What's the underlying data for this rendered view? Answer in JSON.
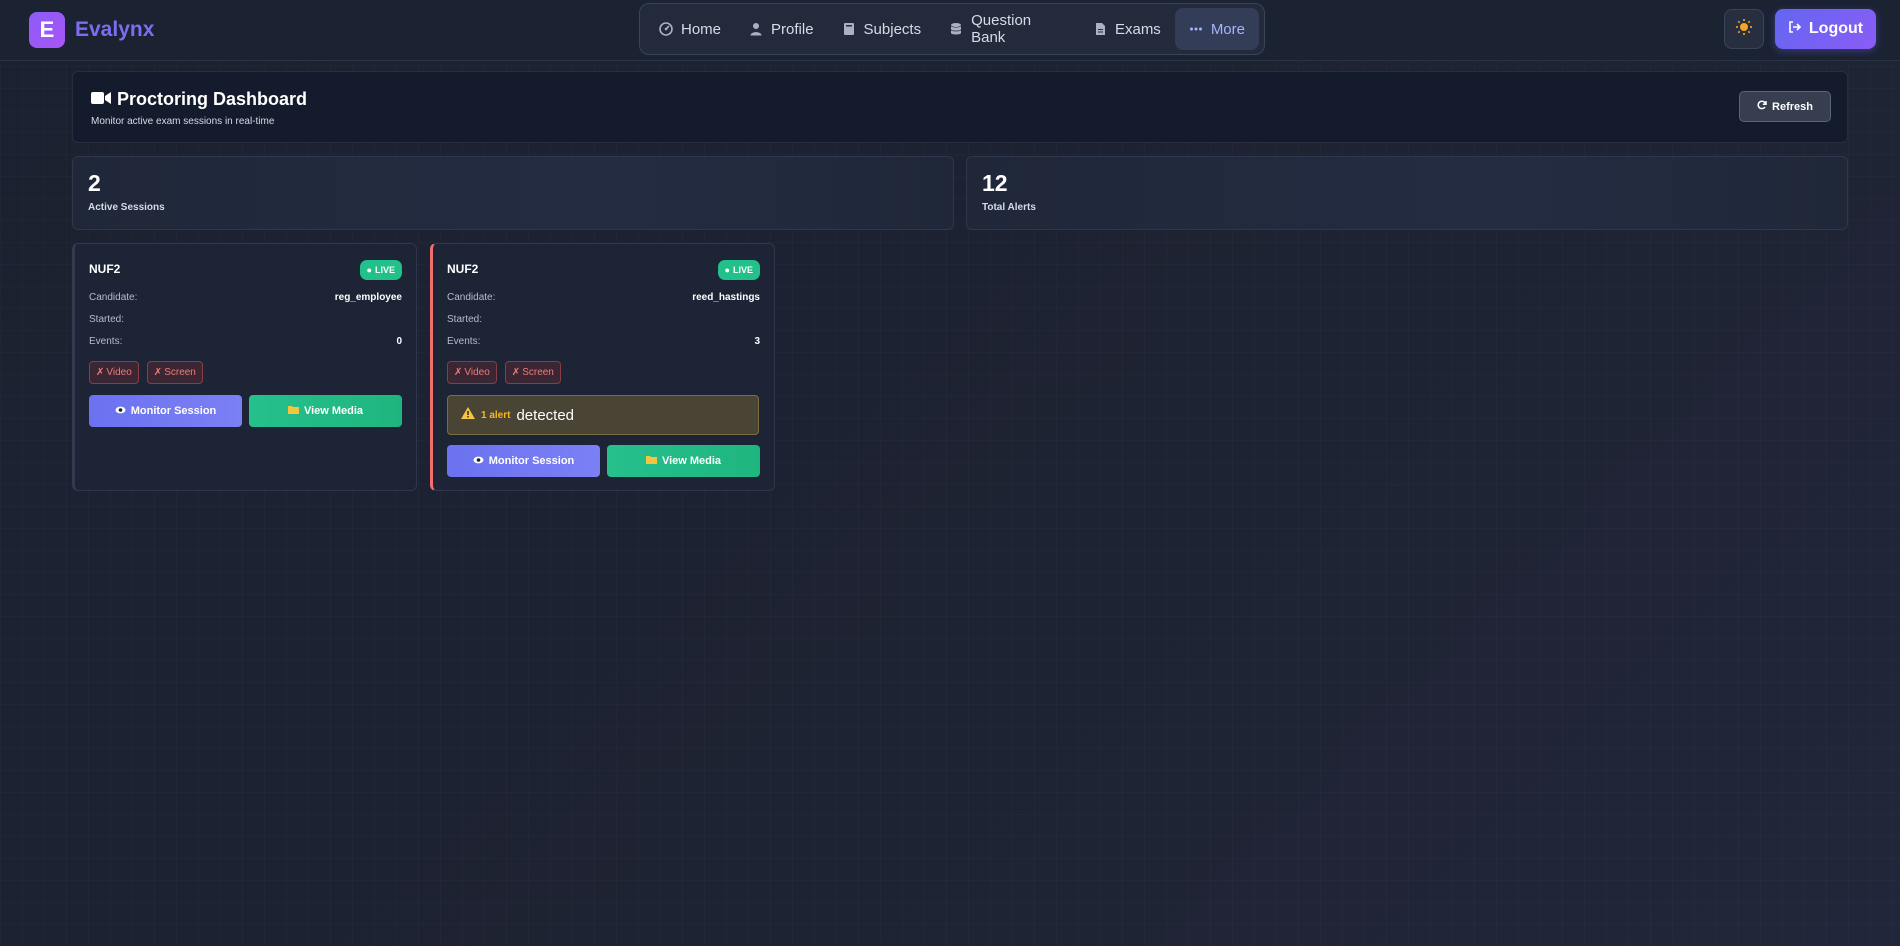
{
  "brand": {
    "logo_letter": "E",
    "name": "Evalynx"
  },
  "nav": {
    "items": [
      {
        "label": "Home",
        "icon": "dashboard-icon"
      },
      {
        "label": "Profile",
        "icon": "user-icon"
      },
      {
        "label": "Subjects",
        "icon": "book-icon"
      },
      {
        "label": "Question Bank",
        "icon": "database-icon"
      },
      {
        "label": "Exams",
        "icon": "file-icon"
      },
      {
        "label": "More",
        "icon": "ellipsis-icon",
        "active": true
      }
    ]
  },
  "header_actions": {
    "theme_icon": "sun-icon",
    "logout_label": "Logout"
  },
  "page": {
    "title": "Proctoring Dashboard",
    "subtitle": "Monitor active exam sessions in real-time",
    "refresh_label": "Refresh"
  },
  "stats": [
    {
      "value": "2",
      "label": "Active Sessions"
    },
    {
      "value": "12",
      "label": "Total Alerts"
    }
  ],
  "sessions": [
    {
      "title": "NUF2",
      "badge": "LIVE",
      "candidate_label": "Candidate:",
      "candidate": "reg_employee",
      "started_label": "Started:",
      "started": "",
      "events_label": "Events:",
      "events": "0",
      "chips": [
        "Video",
        "Screen"
      ],
      "monitor_label": "Monitor Session",
      "media_label": "View Media"
    },
    {
      "title": "NUF2",
      "badge": "LIVE",
      "candidate_label": "Candidate:",
      "candidate": "reed_hastings",
      "started_label": "Started:",
      "started": "",
      "events_label": "Events:",
      "events": "3",
      "chips": [
        "Video",
        "Screen"
      ],
      "alert_count": "1 alert",
      "alert_text": "detected",
      "monitor_label": "Monitor Session",
      "media_label": "View Media"
    }
  ],
  "colors": {
    "accent": "#6366f1",
    "live": "#22c08a",
    "alert_border": "#ef6f6f",
    "warning": "#f5b820"
  }
}
